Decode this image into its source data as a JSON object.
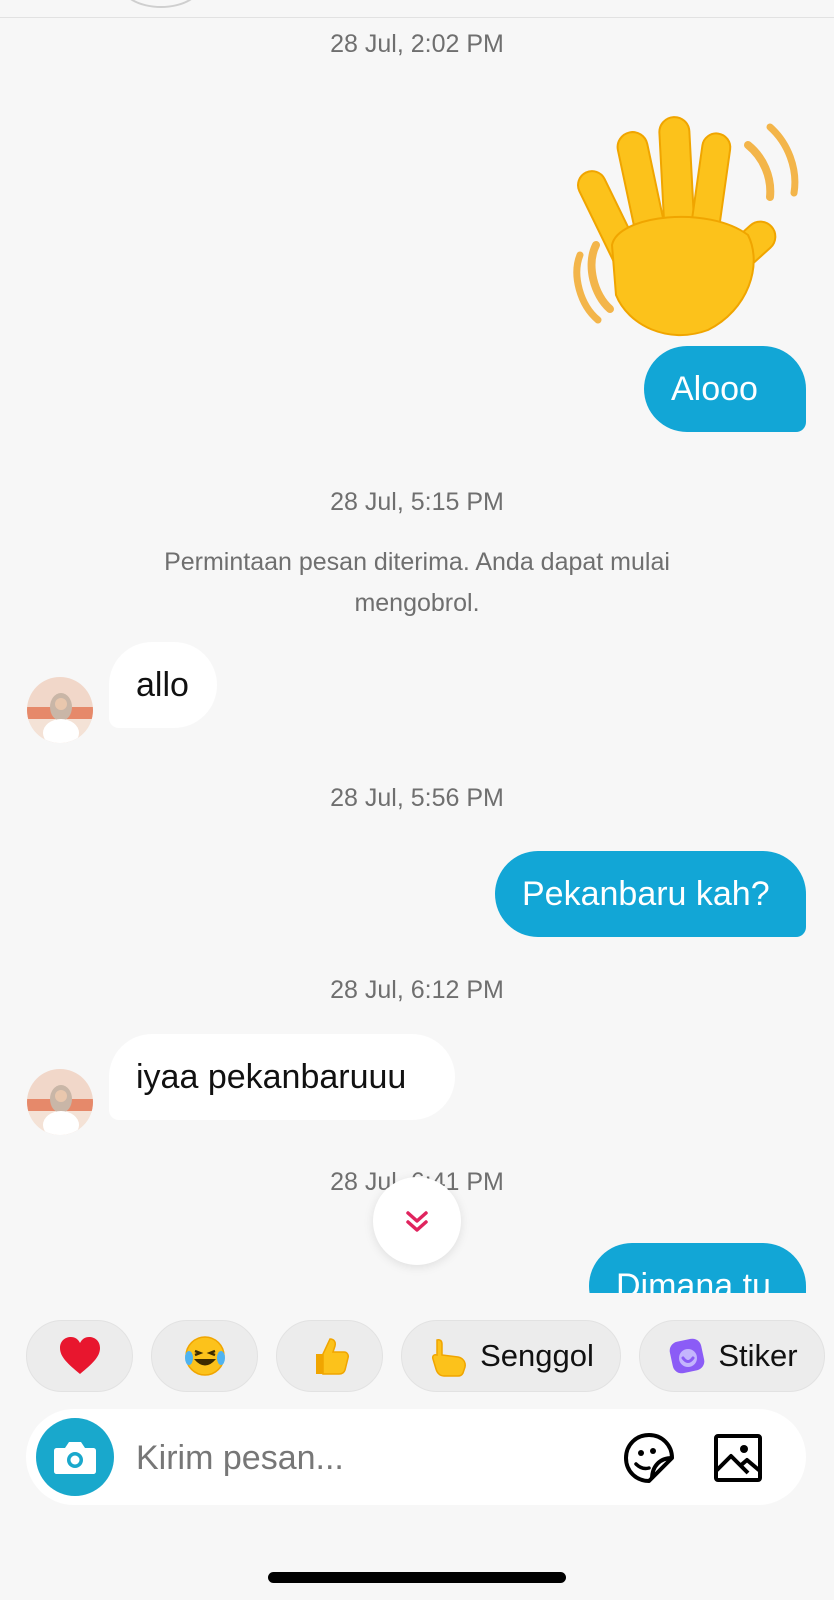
{
  "messages": [
    {
      "type": "timestamp",
      "text": "28 Jul, 2:02 PM"
    },
    {
      "type": "sticker",
      "icon": "waving-hand-icon"
    },
    {
      "type": "outgoing",
      "text": "Alooo"
    },
    {
      "type": "timestamp",
      "text": "28 Jul, 5:15 PM"
    },
    {
      "type": "system",
      "text": "Permintaan pesan diterima. Anda dapat mulai mengobrol."
    },
    {
      "type": "incoming",
      "text": "allo"
    },
    {
      "type": "timestamp",
      "text": "28 Jul, 5:56 PM"
    },
    {
      "type": "outgoing",
      "text": "Pekanbaru kah?"
    },
    {
      "type": "timestamp",
      "text": "28 Jul, 6:12 PM"
    },
    {
      "type": "incoming",
      "text": "iyaa pekanbaruuu"
    },
    {
      "type": "timestamp",
      "text": "28 Jul, 6:41 PM"
    },
    {
      "type": "outgoing",
      "text": "Dimana tu"
    }
  ],
  "quick_actions": [
    {
      "icon": "heart-emoji-icon",
      "label": ""
    },
    {
      "icon": "laughing-tears-emoji-icon",
      "label": ""
    },
    {
      "icon": "thumbs-up-emoji-icon",
      "label": ""
    },
    {
      "icon": "pointing-hand-emoji-icon",
      "label": "Senggol"
    },
    {
      "icon": "sticker-icon",
      "label": "Stiker"
    }
  ],
  "composer": {
    "placeholder": "Kirim pesan...",
    "camera_icon": "camera-icon",
    "sticker_icon": "sticker-face-icon",
    "image_icon": "image-icon"
  },
  "colors": {
    "background": "#f7f7f7",
    "outgoing_bubble": "#12a6d6",
    "incoming_bubble": "#ffffff",
    "camera_button": "#19a8cc",
    "scroll_chevron": "#e0245e"
  }
}
